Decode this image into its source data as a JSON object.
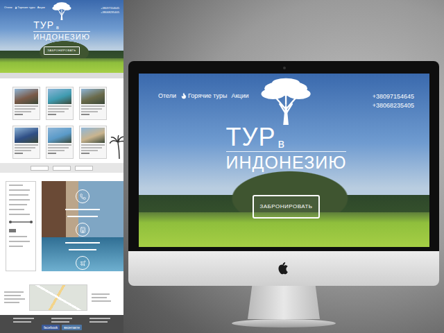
{
  "site": {
    "nav": [
      {
        "label": "Отели",
        "kind": "plain"
      },
      {
        "label": "Горячие туры",
        "kind": "hot"
      },
      {
        "label": "Акции",
        "kind": "plain"
      }
    ],
    "phones": [
      "+38097154645",
      "+38068235405"
    ],
    "logo": {
      "top": "ТУР",
      "small": "в",
      "bottom": "ИНДОНЕЗИЮ"
    },
    "cta": "ЗАБРОНИРОВАТЬ"
  },
  "hotel_cards": [
    {
      "color": "#7a5a48"
    },
    {
      "color": "#3f9bb0"
    },
    {
      "color": "#6a6a4a"
    },
    {
      "color": "#2f4f86"
    },
    {
      "color": "#5a9ac8"
    },
    {
      "color": "#c9b48e"
    }
  ],
  "social": [
    "facebook",
    "вконтакте"
  ]
}
